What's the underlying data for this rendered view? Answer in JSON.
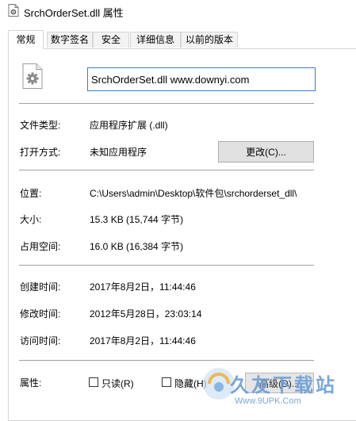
{
  "window": {
    "title": "SrchOrderSet.dll 属性",
    "icon": "dll-file-icon"
  },
  "tabs": [
    {
      "label": "常规",
      "active": true
    },
    {
      "label": "数字签名",
      "active": false
    },
    {
      "label": "安全",
      "active": false
    },
    {
      "label": "详细信息",
      "active": false
    },
    {
      "label": "以前的版本",
      "active": false
    }
  ],
  "general": {
    "file_name": "SrchOrderSet.dll www.downyi.com",
    "file_icon": "gear-file-icon",
    "file_type_label": "文件类型:",
    "file_type_value": "应用程序扩展 (.dll)",
    "opens_with_label": "打开方式:",
    "opens_with_value": "未知应用程序",
    "change_button": "更改(C)...",
    "location_label": "位置:",
    "location_value": "C:\\Users\\admin\\Desktop\\软件包\\srchorderset_dll\\",
    "size_label": "大小:",
    "size_value": "15.3 KB (15,744 字节)",
    "size_on_disk_label": "占用空间:",
    "size_on_disk_value": "16.0 KB (16,384 字节)",
    "created_label": "创建时间:",
    "created_value": "2017年8月2日，11:44:46",
    "modified_label": "修改时间:",
    "modified_value": "2012年5月28日，23:03:14",
    "accessed_label": "访问时间:",
    "accessed_value": "2017年8月2日，11:44:46",
    "attributes_label": "属性:",
    "readonly_label": "只读(R)",
    "readonly_checked": false,
    "hidden_label": "隐藏(H)",
    "hidden_checked": false,
    "advanced_button": "高级(D)..."
  },
  "watermark": {
    "text": "久友下载站",
    "url": "Www.9UPK.Com"
  },
  "colors": {
    "input_border": "#3a7bd5",
    "button_bg": "#e1e1e1",
    "watermark": "#6a9ed6"
  }
}
